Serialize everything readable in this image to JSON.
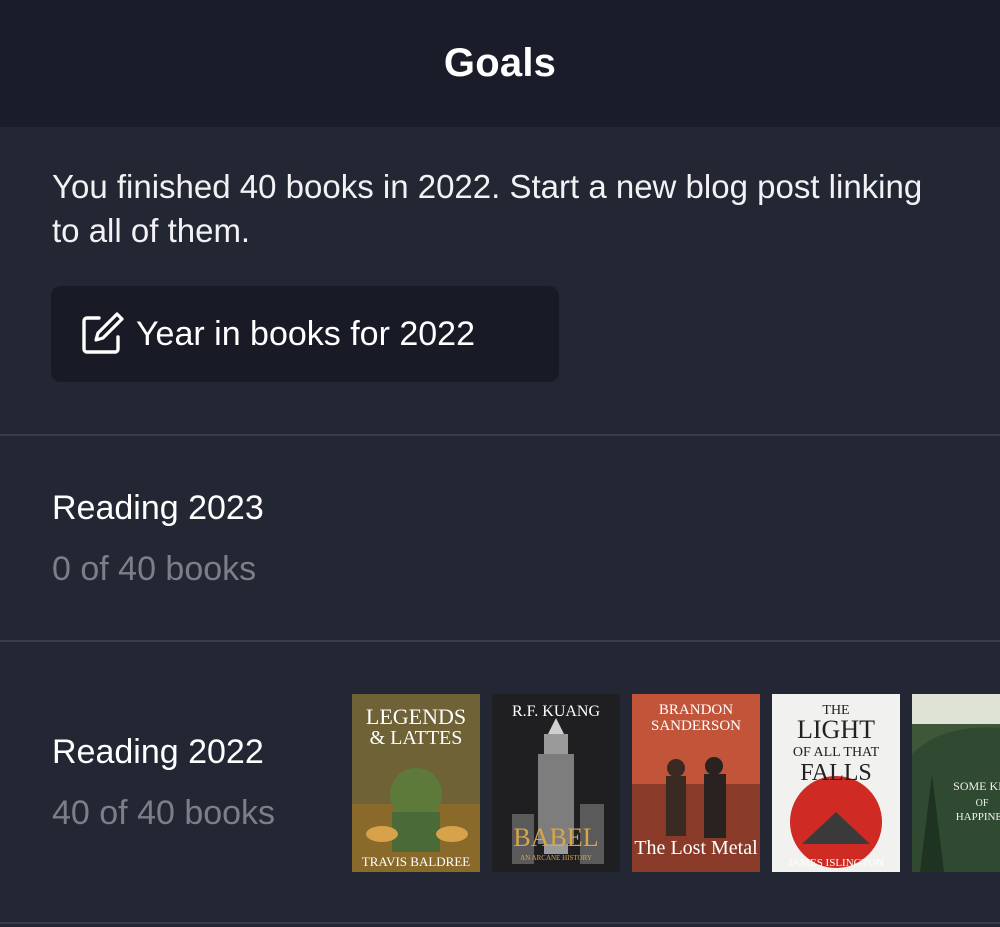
{
  "header": {
    "title": "Goals"
  },
  "finished": {
    "message": "You finished 40 books in 2022. Start a new blog post linking to all of them.",
    "button_label": "Year in books for 2022",
    "button_icon": "compose-icon"
  },
  "goals": [
    {
      "title": "Reading 2023",
      "progress": "0 of 40 books"
    },
    {
      "title": "Reading 2022",
      "progress": "40 of 40 books"
    }
  ],
  "covers": [
    {
      "lines": [
        "LEGENDS",
        "& LATTES"
      ],
      "author": "TRAVIS BALDREE",
      "bg": "#7a6a3c"
    },
    {
      "lines": [
        "R.F. KUANG"
      ],
      "title": "BABEL",
      "subtitle": "AN ARCANE HISTORY",
      "bg": "#2a2a2c"
    },
    {
      "lines": [
        "BRANDON",
        "SANDERSON"
      ],
      "title": "The Lost Metal",
      "bg": "#c4553a"
    },
    {
      "lines": [
        "THE",
        "LIGHT",
        "OF ALL THAT",
        "FALLS"
      ],
      "author": "JAMES ISLINGTON",
      "bg": "#f1f1ef"
    },
    {
      "lines": [
        "SOME KIN",
        "OF",
        "HAPPINES"
      ],
      "bg": "#3f5a3a"
    }
  ]
}
